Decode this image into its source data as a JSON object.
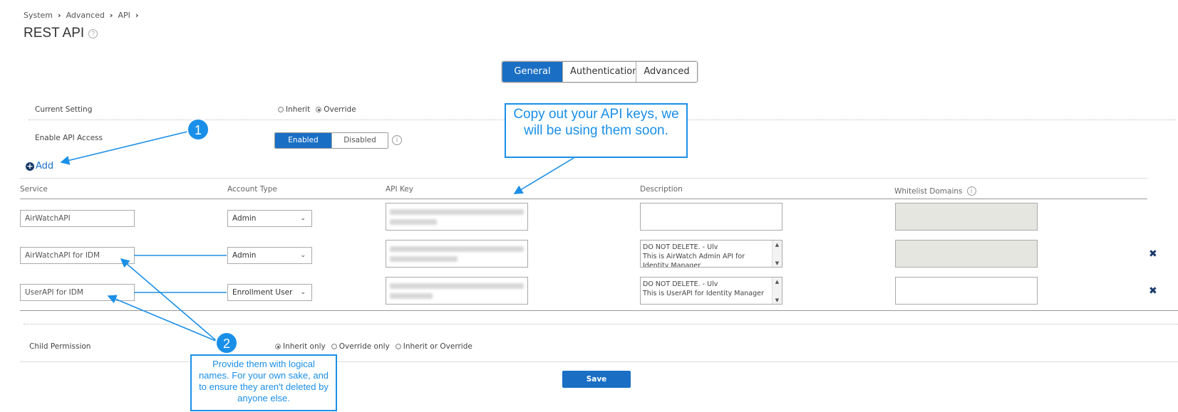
{
  "breadcrumb": [
    "System",
    "Advanced",
    "API"
  ],
  "page_title": "REST API",
  "tabs": [
    "General",
    "Authentication",
    "Advanced"
  ],
  "current_setting": {
    "label": "Current Setting",
    "options": [
      "Inherit",
      "Override"
    ],
    "selected": "Override"
  },
  "enable_api": {
    "label": "Enable API Access",
    "on": "Enabled",
    "off": "Disabled"
  },
  "add_label": "Add",
  "columns": [
    "Service",
    "Account Type",
    "API Key",
    "Description",
    "Whitelist Domains"
  ],
  "rows": [
    {
      "service": "AirWatchAPI",
      "account_type": "Admin",
      "description": []
    },
    {
      "service": "AirWatchAPI for IDM",
      "account_type": "Admin",
      "description": [
        "DO NOT DELETE. - Ulv",
        "This is AirWatch Admin API for",
        "Identity Manager"
      ]
    },
    {
      "service": "UserAPI for IDM",
      "account_type": "Enrollment User",
      "description": [
        "DO NOT DELETE. - Ulv",
        "This is UserAPI for Identity Manager"
      ]
    }
  ],
  "child_permission": {
    "label": "Child Permission",
    "options": [
      "Inherit only",
      "Override only",
      "Inherit or Override"
    ],
    "selected": "Inherit only"
  },
  "save_label": "Save",
  "callouts": {
    "api_keys": "Copy out your API keys, we will be using them soon.",
    "names": "Provide them with logical names. For your own sake, and to ensure they aren't deleted by anyone else."
  },
  "markers": [
    "1",
    "2"
  ],
  "colors": {
    "primary": "#1a6fc4",
    "annotation": "#1a8fe8"
  }
}
